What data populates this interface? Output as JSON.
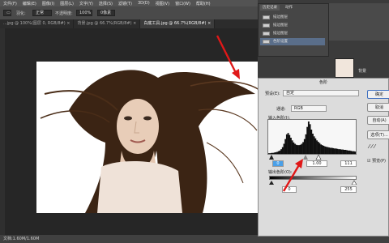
{
  "menu": [
    "文件(F)",
    "编辑(E)",
    "图像(I)",
    "图层(L)",
    "文字(Y)",
    "选择(S)",
    "滤镜(T)",
    "3D(D)",
    "视图(V)",
    "窗口(W)",
    "帮助(H)"
  ],
  "options": {
    "mode": "正常",
    "opacity_label": "不透明度:",
    "opacity": "100%",
    "feather_label": "羽化:",
    "feather": "0像素"
  },
  "tabs": [
    "...jpg @ 100%(图层 0, RGB/8#) ×",
    "背景.jpg @ 66.7%(RGB/8#) ×",
    "白底工具.jpg @ 66.7%(RGB/8#) ×"
  ],
  "history_panel": {
    "tab_history": "历史记录",
    "tab_actions": "动作",
    "items": [
      "描边图层",
      "描边图层",
      "描边图层",
      "色阶设置"
    ]
  },
  "status": "文档:1.60M/1.60M",
  "layers": {
    "layer_name": "背景"
  },
  "levels": {
    "title": "色阶",
    "preset_label": "预设(E):",
    "preset_value": "自定",
    "channel_label": "通道:",
    "channel_value": "RGB",
    "input_label": "输入色阶(I):",
    "output_label": "输出色阶(O):",
    "input_black": "0",
    "input_gamma": "1.00",
    "input_white": "111",
    "output_black": "0",
    "output_white": "255",
    "buttons": {
      "ok": "确定",
      "cancel": "取消",
      "auto": "自动(A)",
      "options": "选项(T)..."
    },
    "preview_label": "预览(P)"
  },
  "histogram": [
    2,
    2,
    3,
    3,
    4,
    5,
    6,
    8,
    10,
    14,
    20,
    30,
    44,
    58,
    62,
    56,
    48,
    40,
    34,
    30,
    27,
    26,
    26,
    27,
    30,
    35,
    44,
    58,
    80,
    96,
    88,
    72,
    60,
    52,
    46,
    40,
    36,
    32,
    28,
    26,
    24,
    22,
    21,
    20,
    19,
    18,
    18,
    17,
    16,
    16,
    15,
    14,
    14,
    13,
    13,
    12,
    12,
    11,
    10,
    10,
    9,
    8,
    8,
    7
  ]
}
